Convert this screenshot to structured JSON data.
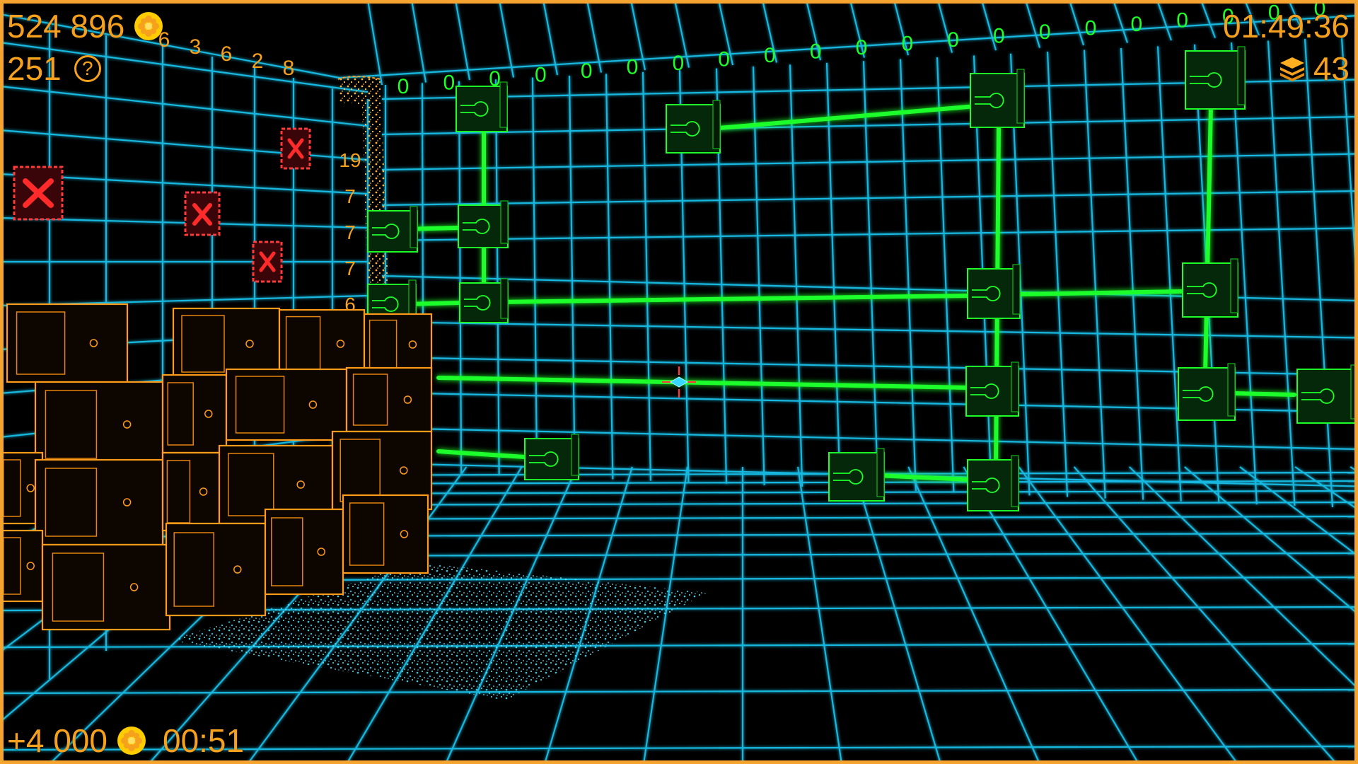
{
  "hud": {
    "coins": "524 896",
    "hints": "251",
    "hint_icon_char": "?",
    "timer": "01:49:36",
    "cubes": "43",
    "reward_amount": "+4 000",
    "reward_time": "00:51"
  },
  "wall_counters": {
    "left_wall_top": [
      "6",
      "3",
      "6",
      "2",
      "8"
    ],
    "left_wall_side": [
      "19",
      "7",
      "7",
      "7",
      "6"
    ],
    "back_wall_top": [
      "0",
      "0",
      "0",
      "0",
      "0",
      "0",
      "0",
      "0",
      "0",
      "0",
      "0",
      "0",
      "0",
      "0",
      "0",
      "0",
      "0",
      "0",
      "0",
      "0",
      "0",
      "0"
    ]
  },
  "icons": {
    "coin": "coin-icon",
    "hint": "question-circle-icon",
    "cubes": "layered-cubes-icon",
    "crosshair": "crosshair-icon",
    "blocked_cell": "red-x-icon"
  },
  "colors": {
    "hud_orange": "#f6a11e",
    "frame_orange": "#f5a430",
    "grid_cyan": "#1ec8f0",
    "circuit_green": "#1eff2a",
    "cube_orange": "#ff9a1a",
    "cross_red": "#ff2a2a"
  }
}
